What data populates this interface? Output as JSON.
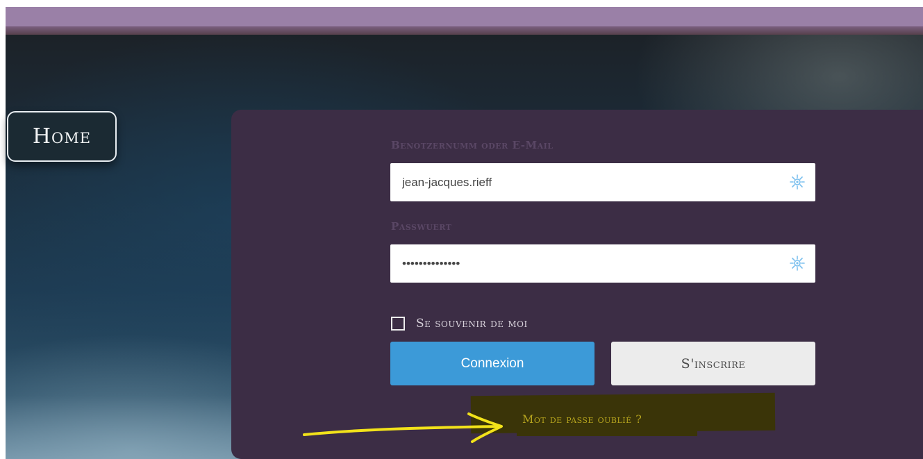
{
  "nav": {
    "home_label": "Home"
  },
  "login": {
    "username_label": "Benotzernumm oder E-Mail",
    "username_value": "jean-jacques.rieff",
    "password_label": "Passwuert",
    "password_value": "••••••••••••••",
    "remember_label": "Se souvenir de moi",
    "remember_checked": false,
    "login_button": "Connexion",
    "register_button": "S'inscrire",
    "forgot_link": "Mot de passe oublié ?"
  },
  "colors": {
    "panel": "#3c2d45",
    "primary_button": "#3c9ad8",
    "secondary_button": "#ececec",
    "annotation": "#f2e21a"
  },
  "icons": {
    "field_icon": "password-manager-icon",
    "annotation": "arrow-right-icon"
  }
}
